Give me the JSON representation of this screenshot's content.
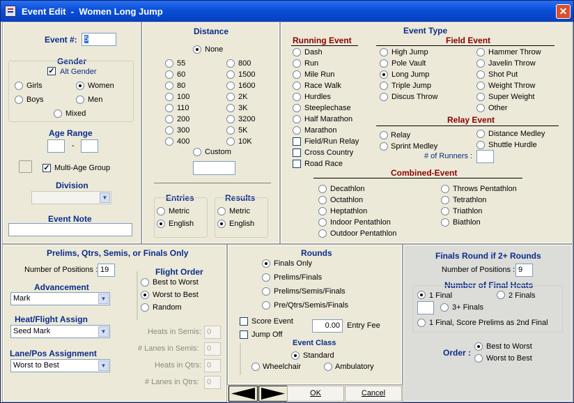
{
  "window": {
    "title": "Event Edit  -  Women Long Jump"
  },
  "event": {
    "label": "Event #:",
    "value": "5"
  },
  "gender": {
    "title": "Gender",
    "alt_gender": "Alt Gender",
    "girls": "Girls",
    "women": "Women",
    "boys": "Boys",
    "men": "Men",
    "mixed": "Mixed"
  },
  "age_range": {
    "title": "Age Range",
    "sep": "-",
    "from": "",
    "to": ""
  },
  "multi_age": "Multi-Age Group",
  "division": {
    "title": "Division",
    "value": ""
  },
  "event_note": {
    "title": "Event Note",
    "value": ""
  },
  "distance": {
    "title": "Distance",
    "none": "None",
    "col1": [
      "55",
      "60",
      "80",
      "100",
      "110",
      "200",
      "300",
      "400"
    ],
    "col2": [
      "800",
      "1500",
      "1600",
      "2K",
      "3K",
      "3200",
      "5K",
      "10K"
    ],
    "custom": "Custom",
    "custom_value": ""
  },
  "entries": {
    "title": "Entries",
    "metric": "Metric",
    "english": "English"
  },
  "results": {
    "title": "Results",
    "metric": "Metric",
    "english": "English"
  },
  "event_type": {
    "title": "Event Type",
    "running_title": "Running Event",
    "running": [
      "Dash",
      "Run",
      "Mile Run",
      "Race Walk",
      "Hurdles",
      "Steeplechase",
      "Half Marathon",
      "Marathon"
    ],
    "running_checks": [
      "Field/Run Relay",
      "Cross Country",
      "Road Race"
    ],
    "field_title": "Field Event",
    "field_col1": [
      "High Jump",
      "Pole Vault",
      "Long Jump",
      "Triple Jump",
      "Discus Throw"
    ],
    "field_col2": [
      "Hammer Throw",
      "Javelin Throw",
      "Shot Put",
      "Weight Throw",
      "Super Weight",
      "Other"
    ],
    "relay_title": "Relay Event",
    "relay": [
      "Relay",
      "Sprint Medley",
      "Distance Medley",
      "Shuttle Hurdle"
    ],
    "runners_label": "# of Runners :",
    "runners_value": "",
    "combined_title": "Combined-Event",
    "combined_col1": [
      "Decathlon",
      "Octathlon",
      "Heptathlon",
      "Indoor Pentathlon",
      "Outdoor Pentathlon"
    ],
    "combined_col2": [
      "Throws Pentathlon",
      "Tetrathlon",
      "Triathlon",
      "Biathlon"
    ]
  },
  "prelims": {
    "title": "Prelims, Qtrs, Semis, or Finals Only",
    "positions_label": "Number of Positions :",
    "positions_value": "19",
    "advancement_title": "Advancement",
    "advancement_value": "Mark",
    "heat_title": "Heat/Flight Assign",
    "heat_value": "Seed Mark",
    "lane_title": "Lane/Pos Assignment",
    "lane_value": "Worst to Best",
    "flight_title": "Flight Order",
    "flight": [
      "Best to Worst",
      "Worst to Best",
      "Random"
    ],
    "heats_semis": "Heats in Semis:",
    "lanes_semis": "# Lanes in Semis:",
    "heats_qtrs": "Heats in Qtrs:",
    "lanes_qtrs": "# Lanes in Qtrs:",
    "zero": "0"
  },
  "rounds": {
    "title": "Rounds",
    "options": [
      "Finals Only",
      "Prelims/Finals",
      "Prelims/Semis/Finals",
      "Pre/Qtrs/Semis/Finals"
    ],
    "score_event": "Score Event",
    "jump_off": "Jump Off",
    "entry_fee_value": "0.00",
    "entry_fee_label": "Entry Fee",
    "class_title": "Event Class",
    "standard": "Standard",
    "wheelchair": "Wheelchair",
    "ambulatory": "Ambulatory"
  },
  "finals": {
    "title": "Finals Round if 2+ Rounds",
    "positions_label": "Number of Positions :",
    "positions_value": "9",
    "heats_title": "Number of Final Heats",
    "one_final": "1 Final",
    "two_final": "2 Finals",
    "three_plus": "3+ Finals",
    "score_prelims": "1 Final, Score Prelims as 2nd Final",
    "order_label": "Order :",
    "best_to_worst": "Best to Worst",
    "worst_to_best": "Worst to Best"
  },
  "buttons": {
    "ok": "OK",
    "cancel": "Cancel"
  }
}
